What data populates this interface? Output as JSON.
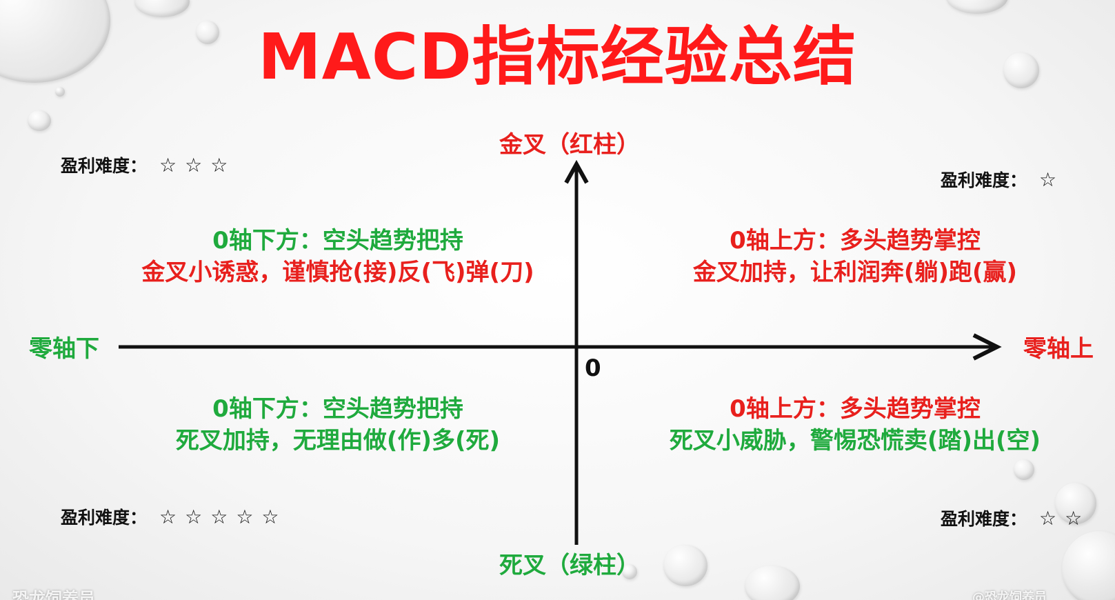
{
  "title": "MACD指标经验总结",
  "axes": {
    "top": "金叉（红柱）",
    "bottom": "死叉（绿柱）",
    "left": "零轴下",
    "right": "零轴上",
    "origin": "0"
  },
  "quadrants": {
    "top_left": {
      "line1": "0轴下方：空头趋势把持",
      "line2": "金叉小诱惑，谨慎抢(接)反(飞)弹(刀)"
    },
    "top_right": {
      "line1": "0轴上方：多头趋势掌控",
      "line2": "金叉加持，让利润奔(躺)跑(赢)"
    },
    "bottom_left": {
      "line1": "0轴下方：空头趋势把持",
      "line2": "死叉加持，无理由做(作)多(死)"
    },
    "bottom_right": {
      "line1": "0轴上方：多头趋势掌控",
      "line2": "死叉小威胁，警惕恐慌卖(踏)出(空)"
    }
  },
  "ratings": {
    "label": "盈利难度：",
    "top_left": {
      "stars": "☆☆☆",
      "level": 3
    },
    "top_right": {
      "stars": "☆",
      "level": 1
    },
    "bottom_left": {
      "stars": "☆☆☆☆☆",
      "level": 5
    },
    "bottom_right": {
      "stars": "☆☆",
      "level": 2
    }
  },
  "colors": {
    "title": "#ff1a1a",
    "red_text": "#e8201d",
    "green_text": "#1faa3d",
    "axis": "#111111"
  },
  "footer": {
    "left": "恐龙饲养员",
    "right": "@恐龙饲养员"
  }
}
